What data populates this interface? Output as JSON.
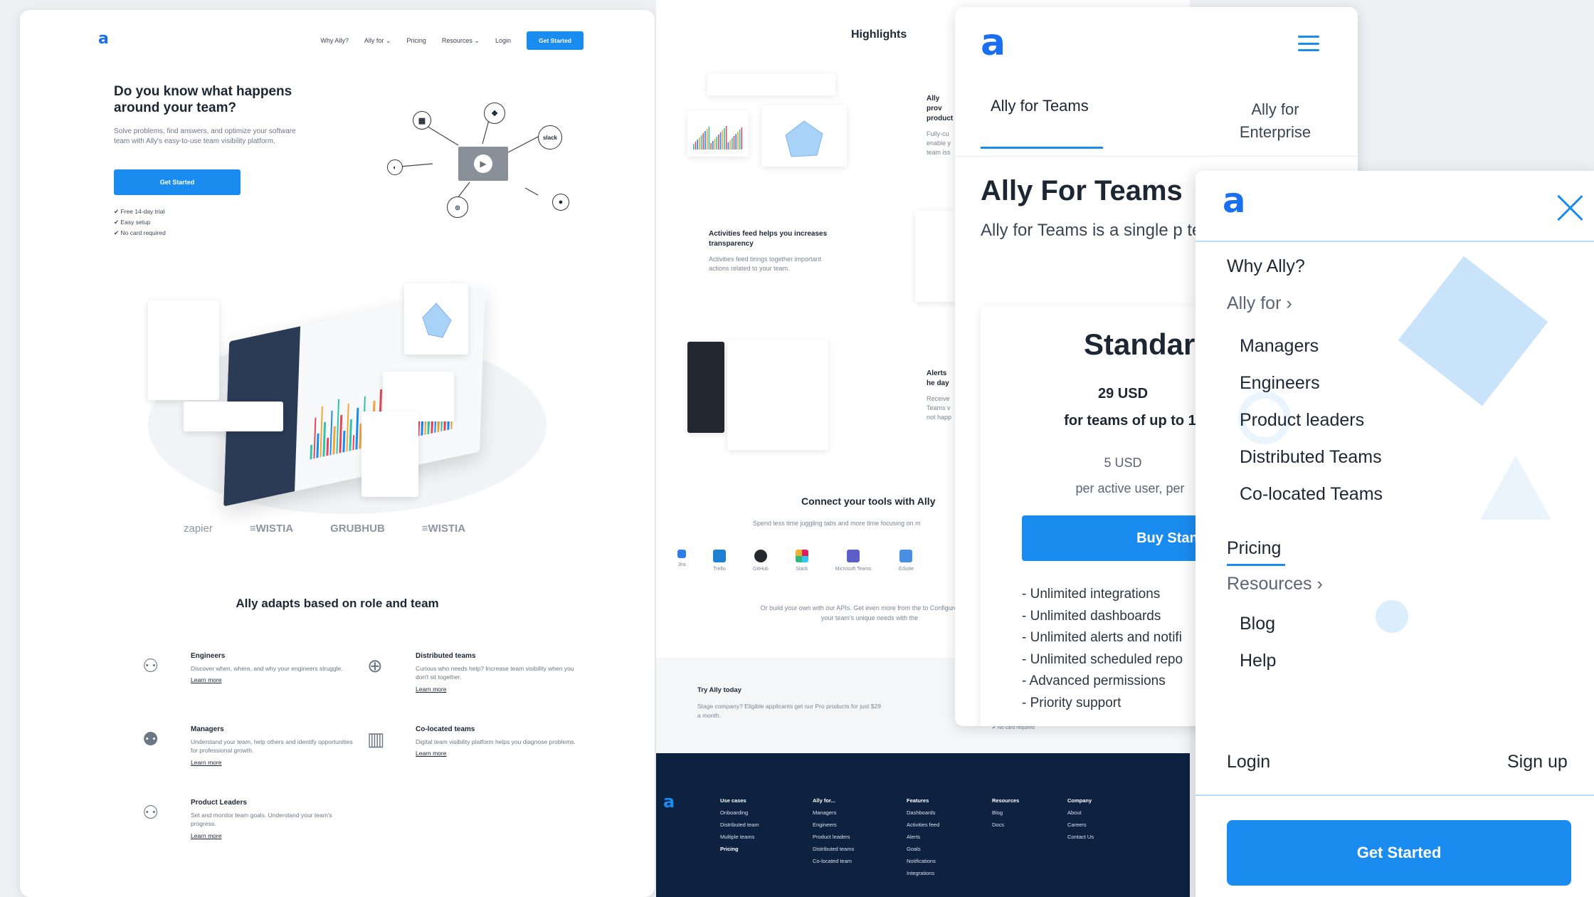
{
  "landing": {
    "nav": {
      "items": [
        "Why Ally?",
        "Ally for ⌄",
        "Pricing",
        "Resources ⌄",
        "Login"
      ],
      "cta": "Get Started"
    },
    "hero": {
      "title": "Do you know what happens around your team?",
      "subtitle": "Solve problems, find answers, and optimize your software team with Ally's easy-to-use team visibility platform.",
      "cta": "Get Started",
      "checks": [
        "✔ Free 14-day trial",
        "✔ Easy setup",
        "✔ No card required"
      ]
    },
    "integrations": [
      "slack"
    ],
    "logos": [
      "zapier",
      "≡WISTIA",
      "GRUBHUB",
      "≡WISTIA"
    ],
    "adapts_title": "Ally adapts based on role and team",
    "features": [
      {
        "title": "Engineers",
        "text": "Discover when, where, and why your engineers struggle.",
        "link": "Learn more"
      },
      {
        "title": "Distributed teams",
        "text": "Curious who needs help? Increase team visibility when you don't sit together.",
        "link": "Learn more"
      },
      {
        "title": "Managers",
        "text": "Understand your team, help others and identify opportunities for professional growth.",
        "link": "Learn more"
      },
      {
        "title": "Co-located teams",
        "text": "Digital team visibility platform helps you diagnose problems.",
        "link": "Learn more"
      },
      {
        "title": "Product Leaders",
        "text": "Set and monitor team goals. Understand your team's progress.",
        "link": "Learn more"
      }
    ]
  },
  "highlights": {
    "title": "Highlights",
    "blocks": [
      {
        "title": "Ally prov product",
        "text": "Fully-cu enable y team iss"
      },
      {
        "title": "Activities feed helps you increases transparency",
        "text": "Activities feed brings together important actions related to your team."
      },
      {
        "title": "Alerts he day",
        "text": "Receive Teams v not happ"
      }
    ],
    "connect_title": "Connect your tools with Ally",
    "connect_sub": "Spend less time juggling tabs and more time focusing on m",
    "tools": [
      "Jira",
      "Trello",
      "GitHub",
      "Slack",
      "Microsoft Teams",
      "GSuite"
    ],
    "build_text": "Or build your own with our APIs. Get even more from the to Configure Ally for your team's unique needs with the",
    "try_title": "Try Ally today",
    "try_text": "Stage company? Eligible applicants get our Pro products for just $29 a month.",
    "no_card": "✔ No card required",
    "footer": [
      {
        "heading": "Use cases",
        "items": [
          "Onboarding",
          "Distributed team",
          "Multiple teams",
          "Pricing"
        ]
      },
      {
        "heading": "Ally for...",
        "items": [
          "Managers",
          "Engineers",
          "Product leaders",
          "Distributed teams",
          "Co-located team"
        ]
      },
      {
        "heading": "Features",
        "items": [
          "Dashboards",
          "Activities feed",
          "Alerts",
          "Goals",
          "Notifications",
          "Integrations"
        ]
      },
      {
        "heading": "Resources",
        "items": [
          "Blog",
          "Docs"
        ]
      },
      {
        "heading": "Company",
        "items": [
          "About",
          "Careers",
          "Contact Us"
        ]
      }
    ]
  },
  "pricing_mobile": {
    "tab_teams": "Ally for Teams",
    "tab_enterprise": "Ally for Enterprise",
    "heading": "Ally For Teams",
    "subtitle": "Ally for Teams is a single p team visibility.",
    "plan": {
      "name": "Standar",
      "price": "29 USD",
      "teams": "for teams of up to 1",
      "per_user": "5 USD",
      "per_user_note": "per active user, per",
      "button": "Buy Standar",
      "features": [
        "- Unlimited integrations",
        "- Unlimited dashboards",
        "- Unlimited alerts and notifi",
        "- Unlimited scheduled repo",
        "- Advanced permissions",
        "- Priority support"
      ]
    }
  },
  "menu_mobile": {
    "items": [
      "Why Ally?",
      "Ally for ›",
      "Pricing",
      "Resources ›"
    ],
    "ally_for": [
      "Managers",
      "Engineers",
      "Product leaders",
      "Distributed Teams",
      "Co-located Teams"
    ],
    "resources": [
      "Blog",
      "Help"
    ],
    "login": "Login",
    "signup": "Sign up",
    "cta": "Get Started"
  },
  "colors": {
    "accent": "#1a8cf0",
    "footer_bg": "#0d2240",
    "brand_logo": "#1a6ff0"
  }
}
